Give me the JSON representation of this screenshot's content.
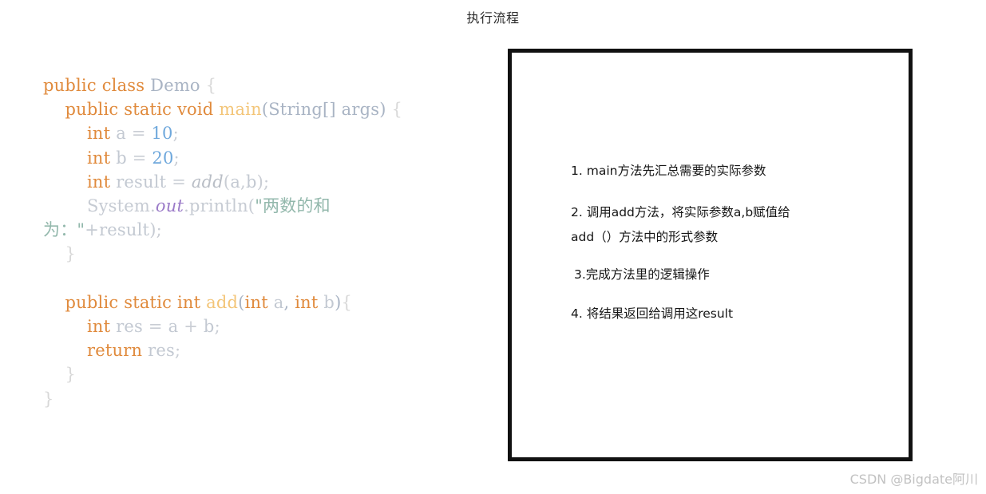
{
  "page": {
    "title": "执行流程",
    "background_color": "#ffffff"
  },
  "code_panel": {
    "language": "java",
    "class_name": "Demo",
    "lines": [
      {
        "id": "l1",
        "text": "public class Demo {"
      },
      {
        "id": "l2",
        "text": "    public static void main(String[] args) {"
      },
      {
        "id": "l3",
        "text": "        int a = 10;"
      },
      {
        "id": "l4",
        "text": "        int b = 20;"
      },
      {
        "id": "l5",
        "text": "        int result = add(a,b);"
      },
      {
        "id": "l6",
        "text": "        System.out.println(\"两数的和"
      },
      {
        "id": "l7",
        "text": "为：\"+result);"
      },
      {
        "id": "l8",
        "text": "    }"
      },
      {
        "id": "l9",
        "text": ""
      },
      {
        "id": "l10",
        "text": "    public static int add(int a, int b){"
      },
      {
        "id": "l11",
        "text": "        int res = a + b;"
      },
      {
        "id": "l12",
        "text": "        return res;"
      },
      {
        "id": "l13",
        "text": "    }"
      },
      {
        "id": "l14",
        "text": "}"
      }
    ],
    "tokens": {
      "kw_public": "public",
      "kw_class": "class",
      "kw_static": "static",
      "kw_void": "void",
      "kw_int": "int",
      "kw_return": "return",
      "type_demo": "Demo",
      "type_string_args": "String[] args",
      "method_main": "main",
      "method_add_decl": "add",
      "call_add": "add",
      "field_out": "out",
      "ident_a": "a",
      "ident_b": "b",
      "ident_res": "res",
      "ident_result": "result",
      "num_10": "10",
      "num_20": "20",
      "string_literal_part1": "\"两数的和",
      "string_literal_part2": "为：\""
    },
    "colors": {
      "keyword": "#e08a3c",
      "type": "#a9b4c4",
      "identifier": "#c3c9d2",
      "number": "#6fa8dc",
      "method": "#f3c578",
      "call": "#b9bec6",
      "field": "#9b7bc8",
      "plain": "#c6cbd3",
      "string": "#93b8ac",
      "brace": "#d8d8d8"
    }
  },
  "flow_box": {
    "border_color": "#111111",
    "items": [
      {
        "id": "step-1",
        "text": "1. main方法先汇总需要的实际参数"
      },
      {
        "id": "step-2",
        "text": "2. 调用add方法，将实际参数a,b赋值给\nadd（）方法中的形式参数"
      },
      {
        "id": "step-3",
        "text": "3.完成方法里的逻辑操作"
      },
      {
        "id": "step-4",
        "text": "4. 将结果返回给调用这result"
      }
    ]
  },
  "watermark": {
    "text": "CSDN @Bigdate阿川",
    "color": "#c2c2c2"
  }
}
